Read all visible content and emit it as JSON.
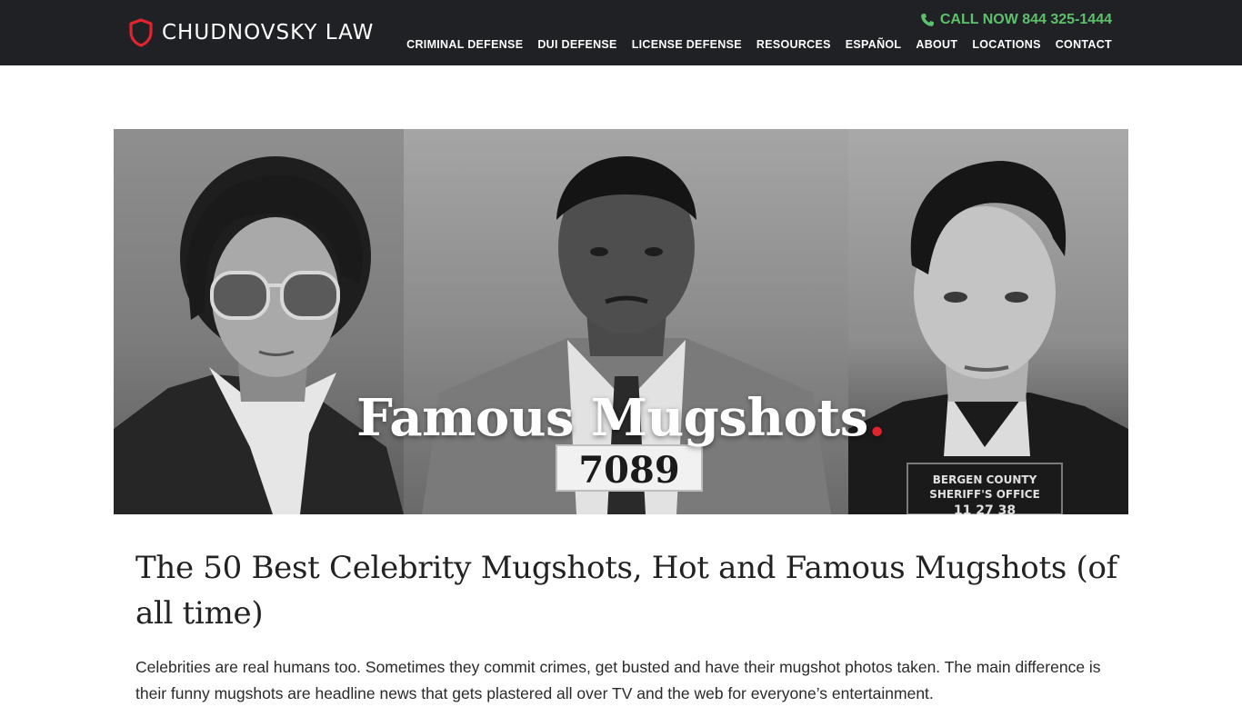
{
  "header": {
    "logo_text": "CHUDNOVSKY LAW",
    "call_now": "CALL NOW 844 325-1444",
    "nav": [
      {
        "label": "CRIMINAL DEFENSE"
      },
      {
        "label": "DUI DEFENSE"
      },
      {
        "label": "LICENSE DEFENSE"
      },
      {
        "label": "RESOURCES"
      },
      {
        "label": "ESPAÑOL"
      },
      {
        "label": "ABOUT"
      },
      {
        "label": "LOCATIONS"
      },
      {
        "label": "CONTACT"
      }
    ]
  },
  "hero": {
    "title": "Famous Mugshots",
    "title_dot": ".",
    "placard_number": "7089",
    "placard_right_line1": "BERGEN COUNTY",
    "placard_right_line2": "SHERIFF'S OFFICE",
    "placard_right_line3": "11 27 38"
  },
  "article": {
    "title": "The 50 Best Celebrity Mugshots, Hot and Famous Mugshots (of all time)",
    "intro": "Celebrities are real humans too. Sometimes they commit crimes, get busted and have their mugshot photos taken. The main difference is their funny mugshots are headline news that gets plastered all over TV and the web for everyone’s entertainment."
  },
  "colors": {
    "header_bg": "#1f2124",
    "accent_green": "#5cc16a",
    "accent_red": "#e0242f"
  }
}
